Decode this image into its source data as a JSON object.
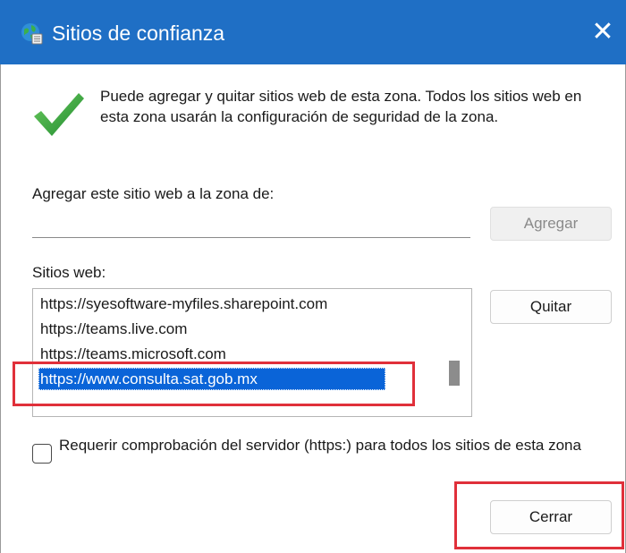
{
  "window": {
    "title": "Sitios de confianza",
    "close_glyph": "✕"
  },
  "info": {
    "text": "Puede agregar y quitar sitios web de esta zona. Todos los sitios web en esta zona usarán la configuración de seguridad de la zona.",
    "icon": "checkmark-icon"
  },
  "add_section": {
    "label": "Agregar este sitio web a la zona de:",
    "input_value": "",
    "button_label": "Agregar"
  },
  "sites_section": {
    "label": "Sitios web:",
    "items": [
      "https://syesoftware-myfiles.sharepoint.com",
      "https://teams.live.com",
      "https://teams.microsoft.com",
      "https://www.consulta.sat.gob.mx"
    ],
    "remove_label": "Quitar"
  },
  "require_https": {
    "checked": false,
    "label": "Requerir comprobación del servidor (https:) para todos los sitios de esta zona"
  },
  "footer": {
    "close_label": "Cerrar"
  },
  "colors": {
    "titlebar": "#1f6fc5",
    "selection": "#0a64d8",
    "highlight": "#e0303a",
    "check_green": "#2e9e3c"
  }
}
